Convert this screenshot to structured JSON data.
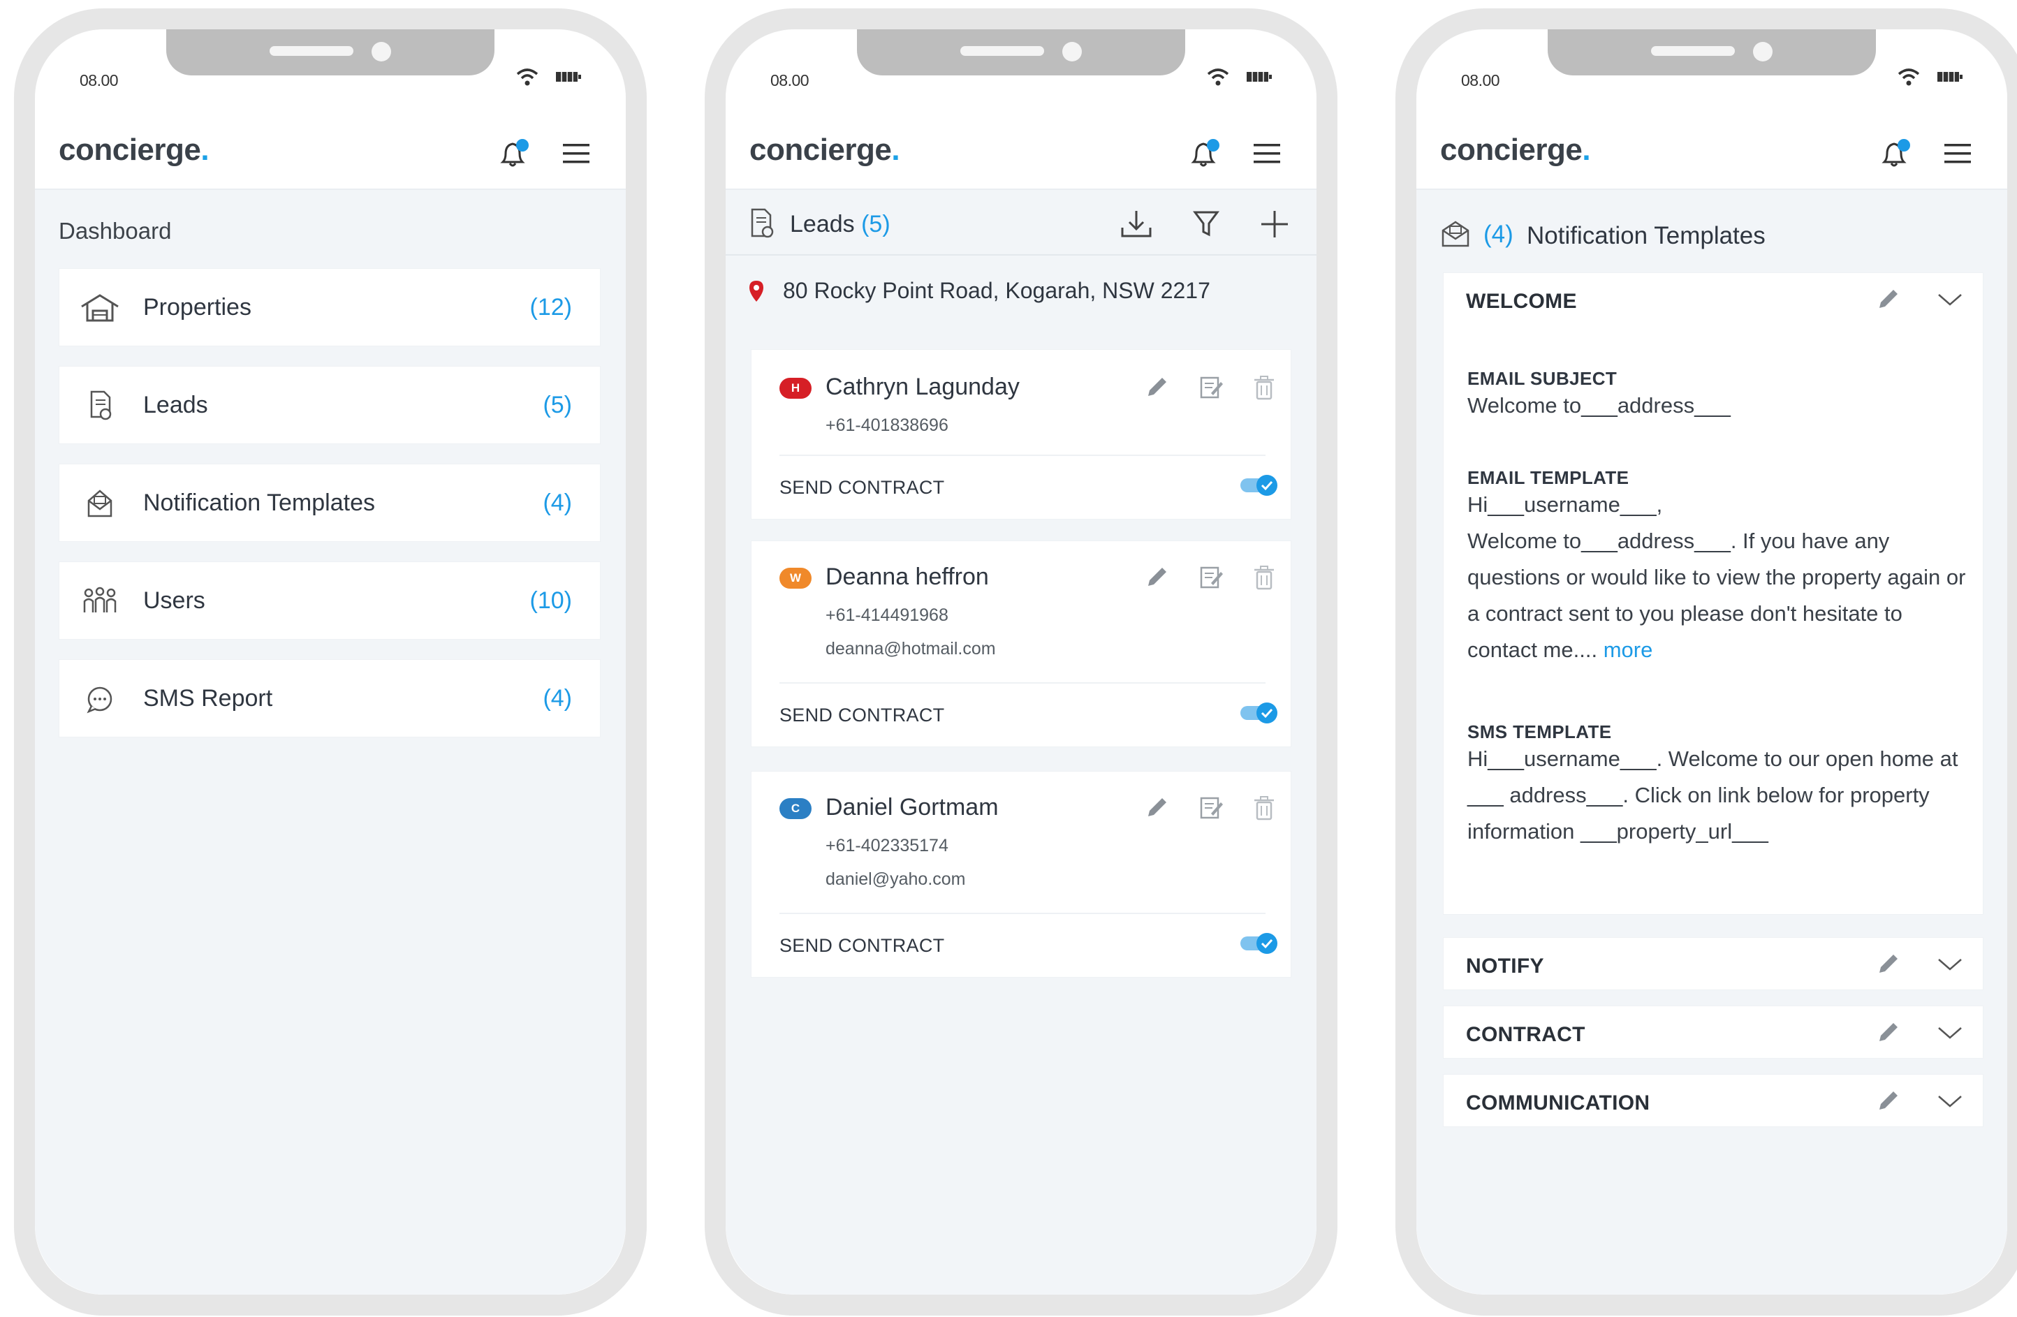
{
  "status_time": "08.00",
  "brand": {
    "name": "concierge",
    "dot": ".",
    "dot_color": "#1ca0e6"
  },
  "colors": {
    "accent": "#1c9ae6",
    "hot": "#d61f26",
    "warm": "#f0892a",
    "cold": "#2b7fc4"
  },
  "dashboard": {
    "title": "Dashboard",
    "items": [
      {
        "label": "Properties",
        "count": "(12)",
        "icon": "house-icon"
      },
      {
        "label": "Leads",
        "count": "(5)",
        "icon": "document-icon"
      },
      {
        "label": "Notification Templates",
        "count": "(4)",
        "icon": "envelope-icon"
      },
      {
        "label": "Users",
        "count": "(10)",
        "icon": "users-icon"
      },
      {
        "label": "SMS Report",
        "count": "(4)",
        "icon": "chat-icon"
      }
    ]
  },
  "leads": {
    "title": "Leads",
    "count": "(5)",
    "address": "80 Rocky Point Road, Kogarah, NSW 2217",
    "cards": [
      {
        "badge": "H",
        "name": "Cathryn Lagunday",
        "phone": "+61-401838696",
        "email": "",
        "action": "SEND CONTRACT"
      },
      {
        "badge": "W",
        "name": "Deanna heffron",
        "phone": "+61-414491968",
        "email": "deanna@hotmail.com",
        "action": "SEND CONTRACT"
      },
      {
        "badge": "C",
        "name": "Daniel Gortmam",
        "phone": "+61-402335174",
        "email": "daniel@yaho.com",
        "action": "SEND CONTRACT"
      }
    ]
  },
  "templates": {
    "title": "Notification Templates",
    "count": "(4)",
    "welcome": {
      "title": "WELCOME",
      "email_subject_label": "EMAIL SUBJECT",
      "email_subject": "Welcome to___address___",
      "email_template_label": "EMAIL TEMPLATE",
      "email_template_line1": "Hi___username___,",
      "email_template_body": "Welcome to___address___. If you have any questions or would like to view the property again or a contract sent to you please don't hesitate to contact me....",
      "more": "more",
      "sms_template_label": "SMS TEMPLATE",
      "sms_template": "Hi___username___. Welcome to our open home at ___ address___. Click on link below for property information ___property_url___"
    },
    "sections": [
      "NOTIFY",
      "CONTRACT",
      "COMMUNICATION"
    ]
  }
}
